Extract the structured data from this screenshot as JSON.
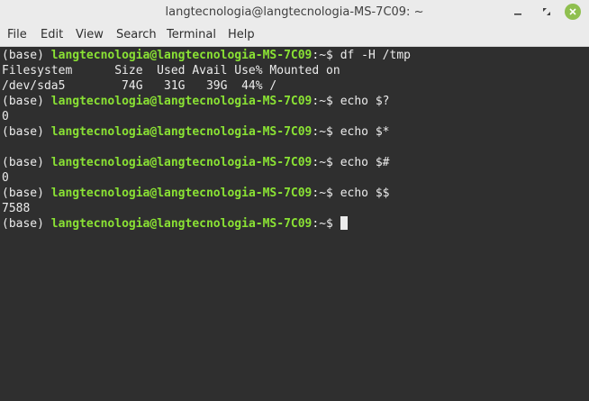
{
  "window": {
    "title": "langtecnologia@langtecnologia-MS-7C09: ~",
    "accent_close": "#8fbf4f"
  },
  "menubar": {
    "items": [
      "File",
      "Edit",
      "View",
      "Search",
      "Terminal",
      "Help"
    ]
  },
  "terminal": {
    "env": "(base)",
    "user_host": "langtecnologia@langtecnologia-MS-7C09",
    "path_suffix": ":~$",
    "lines": [
      {
        "type": "prompt",
        "cmd": "df -H /tmp"
      },
      {
        "type": "output",
        "text": "Filesystem      Size  Used Avail Use% Mounted on"
      },
      {
        "type": "output",
        "text": "/dev/sda5        74G   31G   39G  44% /"
      },
      {
        "type": "prompt",
        "cmd": "echo $?"
      },
      {
        "type": "output",
        "text": "0"
      },
      {
        "type": "prompt",
        "cmd": "echo $*"
      },
      {
        "type": "output",
        "text": ""
      },
      {
        "type": "prompt",
        "cmd": "echo $#"
      },
      {
        "type": "output",
        "text": "0"
      },
      {
        "type": "prompt",
        "cmd": "echo $$"
      },
      {
        "type": "output",
        "text": "7588"
      },
      {
        "type": "prompt",
        "cmd": "",
        "cursor": true
      }
    ],
    "colors": {
      "background": "#2f2f2f",
      "foreground": "#ececec",
      "user_host": "#8ae234"
    }
  }
}
